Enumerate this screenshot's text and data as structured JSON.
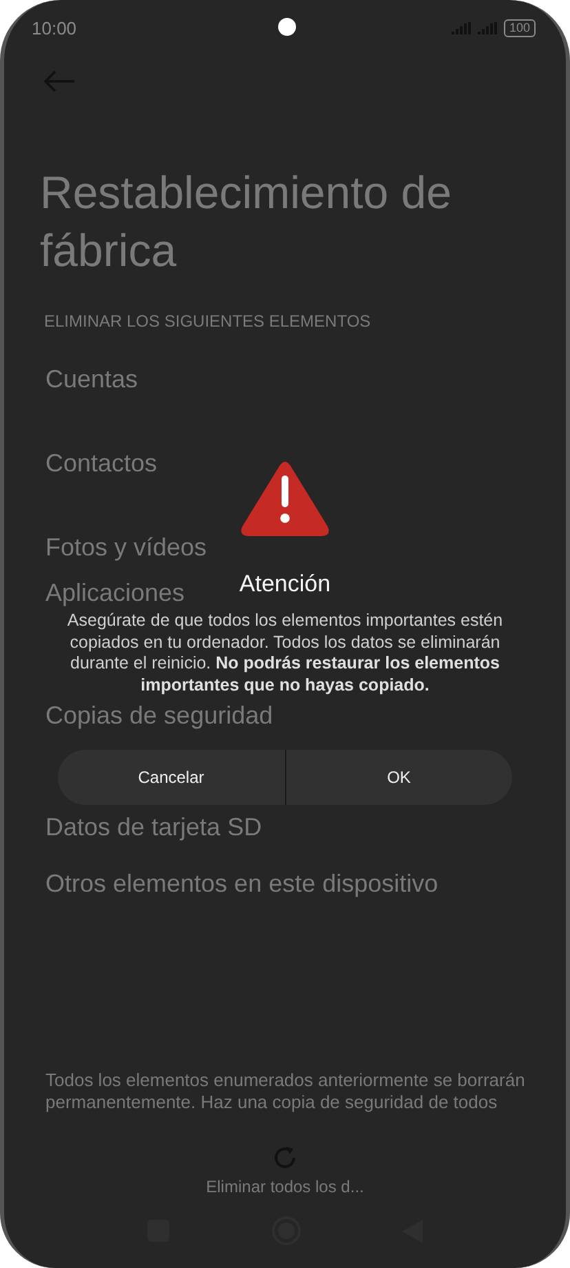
{
  "status_bar": {
    "time": "10:00",
    "battery": "100"
  },
  "page": {
    "title": "Restablecimiento de fábrica",
    "section_header": "ELIMINAR LOS SIGUIENTES ELEMENTOS",
    "items": [
      "Cuentas",
      "Contactos",
      "Fotos y vídeos",
      "Aplicaciones",
      "Copias de seguridad",
      "Datos de tarjeta SD",
      "Otros elementos en este dispositivo"
    ],
    "footer_note": "Todos los elementos enumerados anteriormente se borrarán permanentemente. Haz una copia de seguridad de todos",
    "action_label": "Eliminar todos los d..."
  },
  "dialog": {
    "title": "Atención",
    "message": "Asegúrate de que todos los elementos importantes estén copiados en tu ordenador. Todos los datos se eliminarán durante el reinicio. **No podrás restaurar los elementos importantes que no hayas copiado.**",
    "buttons": [
      "Cancelar",
      "OK"
    ]
  }
}
